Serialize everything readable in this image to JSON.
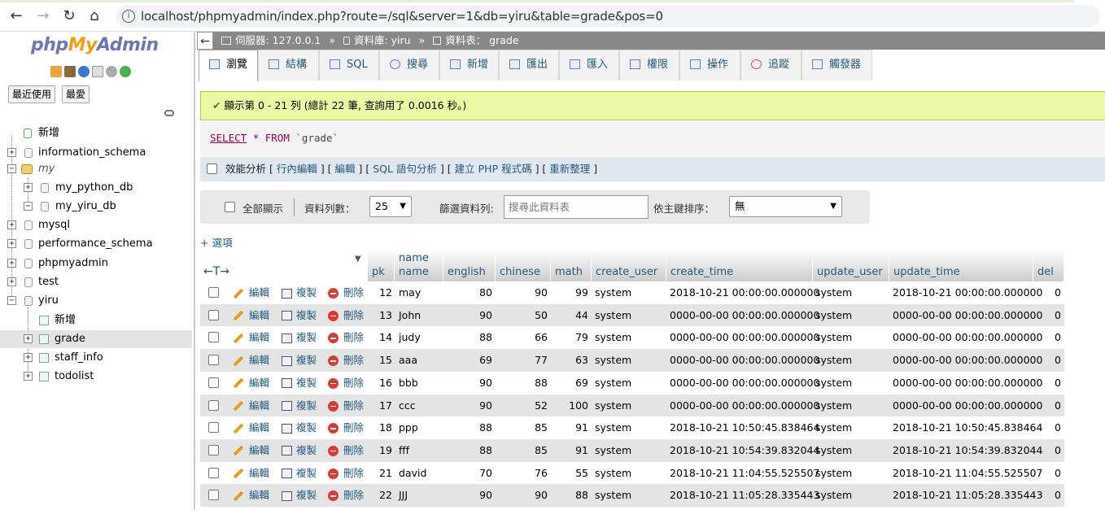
{
  "browser": {
    "url": "localhost/phpmyadmin/index.php?route=/sql&server=1&db=yiru&table=grade&pos=0",
    "back": "←",
    "forward": "→",
    "reload": "↻",
    "home": "⌂",
    "info": "i"
  },
  "sidebar": {
    "logo": {
      "php": "php",
      "my": "My",
      "admin": "Admin"
    },
    "tabs": [
      "最近使用",
      "最愛"
    ],
    "tree": [
      {
        "label": "新增",
        "icon": "new-icon"
      },
      {
        "label": "information_schema",
        "icon": "database-icon"
      },
      {
        "label": "my",
        "icon": "database-group-icon"
      },
      {
        "label": "my_python_db",
        "icon": "database-icon"
      },
      {
        "label": "my_yiru_db",
        "icon": "database-icon"
      },
      {
        "label": "mysql",
        "icon": "database-icon"
      },
      {
        "label": "performance_schema",
        "icon": "database-icon"
      },
      {
        "label": "phpmyadmin",
        "icon": "database-icon"
      },
      {
        "label": "test",
        "icon": "database-icon"
      },
      {
        "label": "yiru",
        "icon": "database-icon"
      },
      {
        "label": "新增",
        "icon": "new-icon"
      },
      {
        "label": "grade",
        "icon": "table-icon"
      },
      {
        "label": "staff_info",
        "icon": "table-icon"
      },
      {
        "label": "todolist",
        "icon": "table-icon"
      }
    ]
  },
  "topbar": {
    "server": "伺服器: 127.0.0.1",
    "database": "資料庫: yiru",
    "table": "資料表： grade",
    "sep": "»"
  },
  "tabs": [
    "瀏覽",
    "結構",
    "SQL",
    "搜尋",
    "新增",
    "匯出",
    "匯入",
    "權限",
    "操作",
    "追蹤",
    "觸發器"
  ],
  "success": {
    "check": "✔",
    "text": "顯示第 0 - 21 列 (總計 22 筆, 查詢用了 0.0016 秒。)"
  },
  "sql": {
    "select": "SELECT",
    "star": "*",
    "from": "FROM",
    "table": "`grade`"
  },
  "profiling": {
    "label": "效能分析",
    "links": [
      "行內編輯",
      "編輯",
      "SQL 語句分析",
      "建立 PHP 程式碼",
      "重新整理"
    ]
  },
  "navigation": {
    "show_all": "全部顯示",
    "rows_label": "資料列數：",
    "rows_value": "25",
    "filter_label": "篩選資料列:",
    "filter_placeholder": "搜尋此資料表",
    "sort_label": "依主鍵排序：",
    "sort_value": "無"
  },
  "options_link": "+ 選項",
  "grid": {
    "arrows": "←T→",
    "columns": [
      "pk",
      "name",
      "english",
      "chinese",
      "math",
      "create_user",
      "create_time",
      "update_user",
      "update_time",
      "del"
    ],
    "name_sort_label": "name",
    "actions": {
      "edit": "編輯",
      "copy": "複製",
      "delete": "刪除"
    },
    "rows": [
      [
        "12",
        "may",
        "80",
        "90",
        "99",
        "system",
        "2018-10-21 00:00:00.000000",
        "system",
        "2018-10-21 00:00:00.000000",
        "0"
      ],
      [
        "13",
        "John",
        "90",
        "50",
        "44",
        "system",
        "0000-00-00 00:00:00.000000",
        "system",
        "0000-00-00 00:00:00.000000",
        "0"
      ],
      [
        "14",
        "judy",
        "88",
        "66",
        "79",
        "system",
        "0000-00-00 00:00:00.000000",
        "system",
        "0000-00-00 00:00:00.000000",
        "0"
      ],
      [
        "15",
        "aaa",
        "69",
        "77",
        "63",
        "system",
        "0000-00-00 00:00:00.000000",
        "system",
        "0000-00-00 00:00:00.000000",
        "0"
      ],
      [
        "16",
        "bbb",
        "90",
        "88",
        "69",
        "system",
        "0000-00-00 00:00:00.000000",
        "system",
        "0000-00-00 00:00:00.000000",
        "0"
      ],
      [
        "17",
        "ccc",
        "90",
        "52",
        "100",
        "system",
        "0000-00-00 00:00:00.000000",
        "system",
        "0000-00-00 00:00:00.000000",
        "0"
      ],
      [
        "18",
        "ppp",
        "88",
        "85",
        "91",
        "system",
        "2018-10-21 10:50:45.838464",
        "system",
        "2018-10-21 10:50:45.838464",
        "0"
      ],
      [
        "19",
        "fff",
        "88",
        "85",
        "91",
        "system",
        "2018-10-21 10:54:39.832044",
        "system",
        "2018-10-21 10:54:39.832044",
        "0"
      ],
      [
        "21",
        "david",
        "70",
        "76",
        "55",
        "system",
        "2018-10-21 11:04:55.525507",
        "system",
        "2018-10-21 11:04:55.525507",
        "0"
      ],
      [
        "22",
        "JJJ",
        "90",
        "90",
        "88",
        "system",
        "2018-10-21 11:05:28.335443",
        "system",
        "2018-10-21 11:05:28.335443",
        "0"
      ]
    ]
  }
}
